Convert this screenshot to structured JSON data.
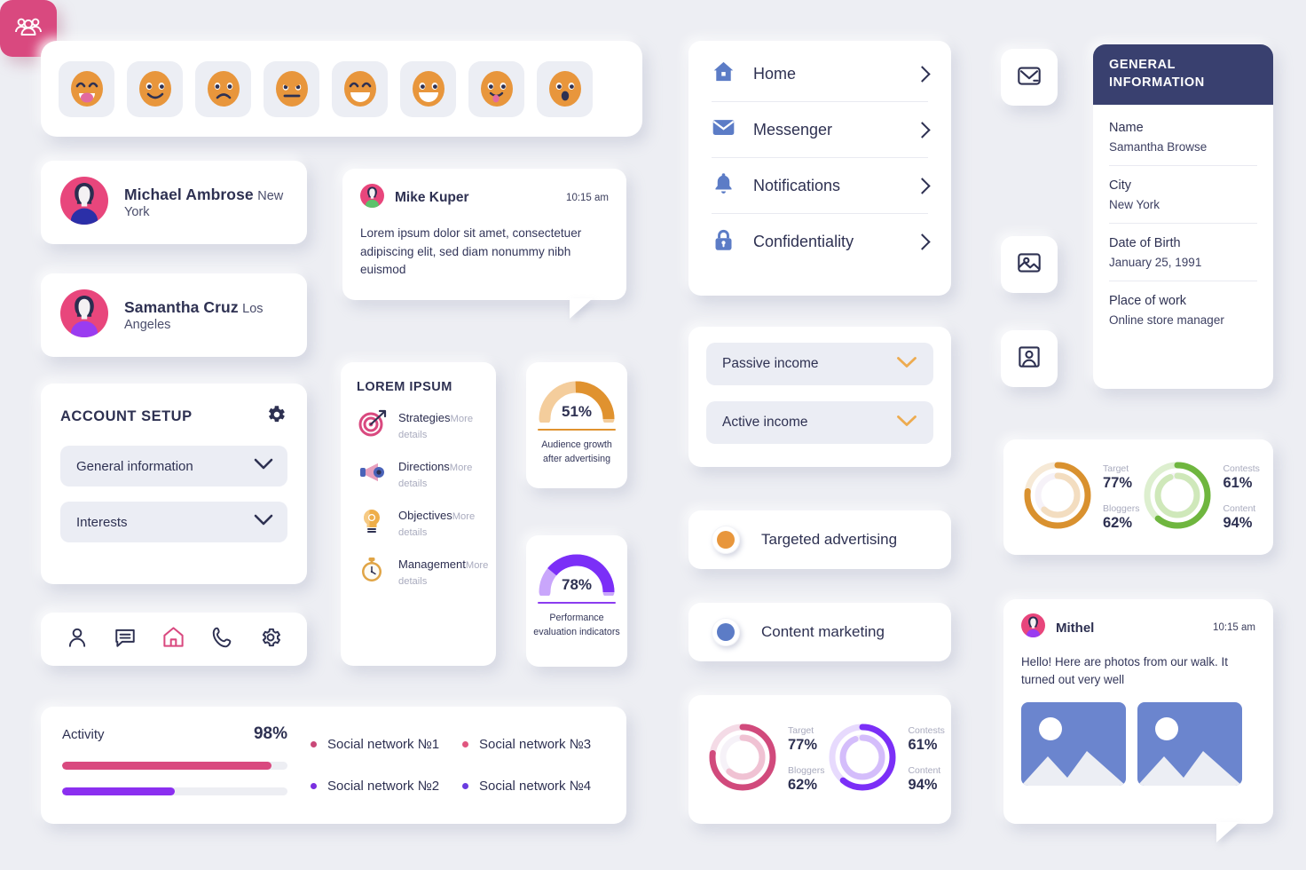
{
  "emoji_bar": {
    "items": [
      {
        "name": "grinning-tongue-emoji",
        "mouth": "tongue",
        "eyes": "closed-arc"
      },
      {
        "name": "smiling-emoji",
        "mouth": "smile",
        "eyes": "open"
      },
      {
        "name": "sad-emoji",
        "mouth": "frown",
        "eyes": "worried"
      },
      {
        "name": "angry-emoji",
        "mouth": "flat",
        "eyes": "angry"
      },
      {
        "name": "laughing-emoji",
        "mouth": "open-laugh",
        "eyes": "closed-arc"
      },
      {
        "name": "grinning-emoji",
        "mouth": "open-laugh",
        "eyes": "open"
      },
      {
        "name": "tongue-out-emoji",
        "mouth": "tongue-small",
        "eyes": "open"
      },
      {
        "name": "surprised-emoji",
        "mouth": "oh",
        "eyes": "open"
      }
    ],
    "face_color": "#e8963c"
  },
  "contacts": [
    {
      "name": "Michael Ambrose",
      "city": "New York",
      "avatar_bg": "#e8467c",
      "avatar_body": "#2b2fa8"
    },
    {
      "name": "Samantha Cruz",
      "city": "Los Angeles",
      "avatar_bg": "#e8467c",
      "avatar_body": "#9a3cf0"
    }
  ],
  "message_mike": {
    "sender": "Mike Kuper",
    "time": "10:15 am",
    "body": "Lorem ipsum dolor sit amet, consectetuer adipiscing elit, sed diam nonummy nibh euismod"
  },
  "account_setup": {
    "title": "ACCOUNT SETUP",
    "gear_icon": "gear-icon",
    "fields": [
      {
        "label": "General information",
        "icon": "chevron-down-icon"
      },
      {
        "label": "Interests",
        "icon": "chevron-down-icon"
      }
    ]
  },
  "bottom_nav": {
    "items": [
      {
        "name": "profile-icon",
        "active": false
      },
      {
        "name": "chat-icon",
        "active": false
      },
      {
        "name": "home-icon",
        "active": true
      },
      {
        "name": "phone-icon",
        "active": false
      },
      {
        "name": "settings-gear-icon",
        "active": false
      }
    ],
    "active_color": "#d9497f",
    "inactive_color": "#2e3152"
  },
  "lorem_list": {
    "title": "LOREM IPSUM",
    "items": [
      {
        "label": "Strategies",
        "sub": "More details",
        "icon": "target-icon"
      },
      {
        "label": "Directions",
        "sub": "More details",
        "icon": "megaphone-icon"
      },
      {
        "label": "Objectives",
        "sub": "More details",
        "icon": "lightbulb-icon"
      },
      {
        "label": "Management",
        "sub": "More details",
        "icon": "stopwatch-icon"
      }
    ]
  },
  "gauges": [
    {
      "value": "51%",
      "percent": 51,
      "caption": "Audience growth after advertising",
      "color": "#e0922f",
      "track": "#f4cd9c"
    },
    {
      "value": "78%",
      "percent": 78,
      "caption": "Performance evaluation indicators",
      "color": "#7b2ff7",
      "track": "#c9a6fb"
    }
  ],
  "activity": {
    "label": "Activity",
    "percent": "98%",
    "bars": [
      {
        "fill": 93,
        "color": "#d9497f"
      },
      {
        "fill": 50,
        "color": "#8b2ff0"
      }
    ],
    "legend": [
      {
        "label": "Social network №1",
        "color": "#c94878"
      },
      {
        "label": "Social network №2",
        "color": "#7a2fe0"
      },
      {
        "label": "Social network №3",
        "color": "#e0567f"
      },
      {
        "label": "Social network №4",
        "color": "#6a3ce0"
      }
    ]
  },
  "nav_menu": {
    "items": [
      {
        "label": "Home",
        "icon": "home-icon"
      },
      {
        "label": "Messenger",
        "icon": "envelope-icon"
      },
      {
        "label": "Notifications",
        "icon": "bell-icon"
      },
      {
        "label": "Confidentiality",
        "icon": "lock-icon"
      }
    ],
    "chevron_icon": "chevron-right-icon",
    "icon_color": "#5c7cc6"
  },
  "income": {
    "items": [
      {
        "label": "Passive income",
        "icon": "chevron-down-icon"
      },
      {
        "label": "Active income",
        "icon": "chevron-down-icon"
      }
    ],
    "chevron_color": "#edab50"
  },
  "radio_options": [
    {
      "label": "Targeted advertising",
      "color": "#e8963c",
      "selected": true
    },
    {
      "label": "Content marketing",
      "color": "#5c7cc6",
      "selected": true
    }
  ],
  "chart_data": [
    {
      "type": "pie",
      "title": "",
      "name": "donut-pink-purple",
      "charts": [
        {
          "palette": [
            "#d14a7c",
            "#f0c2d3"
          ],
          "rings": [
            {
              "label": "Target",
              "value": 77,
              "display": "77%",
              "color": "#d14a7c"
            },
            {
              "label": "Bloggers",
              "value": 62,
              "display": "62%",
              "color": "#f0c2d3"
            }
          ]
        },
        {
          "palette": [
            "#7b2ff7",
            "#d4bdfb"
          ],
          "rings": [
            {
              "label": "Contests",
              "value": 61,
              "display": "61%",
              "color": "#7b2ff7"
            },
            {
              "label": "Content",
              "value": 94,
              "display": "94%",
              "color": "#d4bdfb"
            }
          ]
        }
      ]
    },
    {
      "type": "pie",
      "title": "",
      "name": "donut-orange-green",
      "charts": [
        {
          "palette": [
            "#d9912f",
            "#f3ddc0"
          ],
          "rings": [
            {
              "label": "Target",
              "value": 77,
              "display": "77%",
              "color": "#d9912f"
            },
            {
              "label": "Bloggers",
              "value": 62,
              "display": "62%",
              "color": "#f3ddc0"
            }
          ]
        },
        {
          "palette": [
            "#6fb63f",
            "#cfe8ba"
          ],
          "rings": [
            {
              "label": "Contests",
              "value": 61,
              "display": "61%",
              "color": "#6fb63f"
            },
            {
              "label": "Content",
              "value": 94,
              "display": "94%",
              "color": "#cfe8ba"
            }
          ]
        }
      ]
    }
  ],
  "icon_buttons": [
    {
      "name": "envelope-icon",
      "active": false
    },
    {
      "name": "group-people-icon",
      "active": true
    },
    {
      "name": "image-icon",
      "active": false
    },
    {
      "name": "portrait-icon",
      "active": false
    }
  ],
  "general_information": {
    "title": "GENERAL INFORMATION",
    "header_color": "#39406f",
    "rows": [
      {
        "key": "Name",
        "value": "Samantha Browse"
      },
      {
        "key": "City",
        "value": "New York"
      },
      {
        "key": "Date of Birth",
        "value": "January 25, 1991"
      },
      {
        "key": "Place of work",
        "value": "Online store manager"
      }
    ]
  },
  "message_mithel": {
    "sender": "Mithel",
    "time": "10:15 am",
    "body": "Hello! Here are photos from our walk. It turned out very well",
    "photos": [
      {
        "name": "photo-thumbnail-1",
        "color": "#6b85ce"
      },
      {
        "name": "photo-thumbnail-2",
        "color": "#6b85ce"
      }
    ]
  },
  "theme": {
    "background": "#edeef3",
    "card": "#ffffff",
    "text": "#2e3152",
    "muted": "#a9abbe",
    "pink": "#d9497f",
    "purple": "#7b2ff7",
    "orange": "#e8963c",
    "blue": "#5c7cc6",
    "green": "#6fb63f"
  }
}
